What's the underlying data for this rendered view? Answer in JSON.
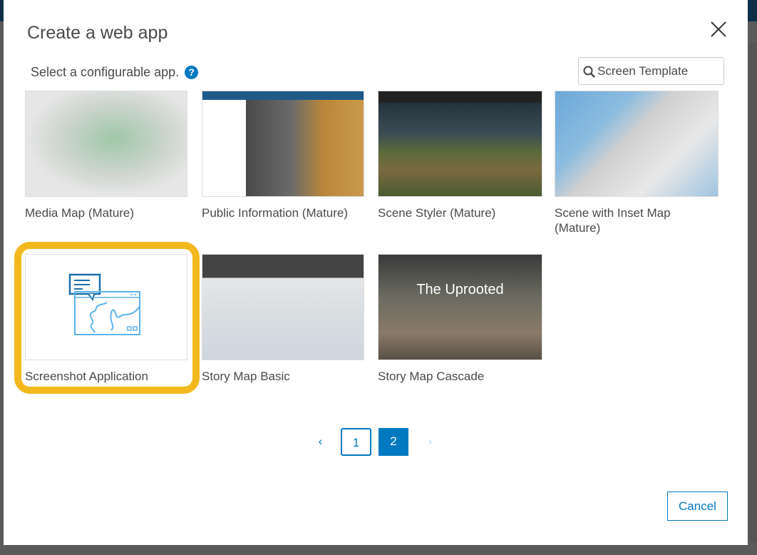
{
  "dialog": {
    "title": "Create a web app",
    "subtitle": "Select a configurable app.",
    "search_value": "Screen Template",
    "cancel_label": "Cancel"
  },
  "apps": [
    {
      "label": "Media Map (Mature)"
    },
    {
      "label": "Public Information (Mature)"
    },
    {
      "label": "Scene Styler (Mature)"
    },
    {
      "label": "Scene with Inset Map (Mature)"
    },
    {
      "label": "Screenshot Application",
      "selected": true
    },
    {
      "label": "Story Map Basic"
    },
    {
      "label": "Story Map Cascade",
      "thumb_text": "The Uprooted"
    }
  ],
  "pagination": {
    "prev": "‹",
    "pages": [
      "1",
      "2"
    ],
    "current": "2",
    "next": "›"
  },
  "colors": {
    "accent": "#0079c1",
    "highlight": "#f2b91f"
  }
}
